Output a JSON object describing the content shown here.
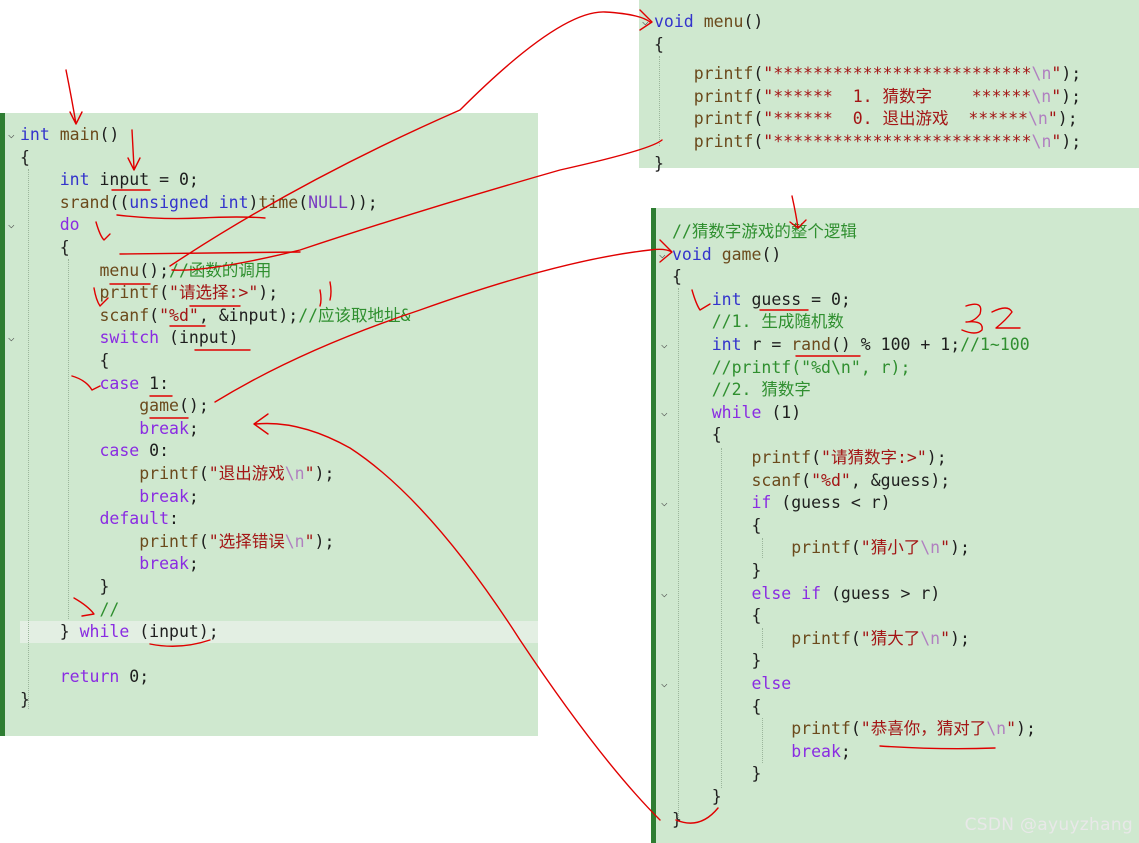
{
  "main_panel": {
    "lines": [
      "int main()",
      "{",
      "    int input = 0;",
      "    srand((unsigned int)time(NULL));",
      "    do",
      "    {",
      "        menu();//函数的调用",
      "        printf(\"请选择:>\");",
      "        scanf(\"%d\", &input);//应该取地址&",
      "        switch (input)",
      "        {",
      "        case 1:",
      "            game();",
      "            break;",
      "        case 0:",
      "            printf(\"退出游戏\\n\");",
      "            break;",
      "        default:",
      "            printf(\"选择错误\\n\");",
      "            break;",
      "        }",
      "        //",
      "    } while (input);",
      "",
      "    return 0;",
      "}"
    ]
  },
  "menu_panel": {
    "lines": [
      "void menu()",
      "{",
      "    printf(\"**************************\\n\");",
      "    printf(\"******  1. 猜数字    ******\\n\");",
      "    printf(\"******  0. 退出游戏  ******\\n\");",
      "    printf(\"**************************\\n\");",
      "}"
    ]
  },
  "game_panel": {
    "lines": [
      "//猜数字游戏的整个逻辑",
      "void game()",
      "{",
      "    int guess = 0;",
      "    //1. 生成随机数",
      "    int r = rand() % 100 + 1;//1~100",
      "    //printf(\"%d\\n\", r);",
      "    //2. 猜数字",
      "    while (1)",
      "    {",
      "        printf(\"请猜数字:>\");",
      "        scanf(\"%d\", &guess);",
      "        if (guess < r)",
      "        {",
      "            printf(\"猜小了\\n\");",
      "        }",
      "        else if (guess > r)",
      "        {",
      "            printf(\"猜大了\\n\");",
      "        }",
      "        else",
      "        {",
      "            printf(\"恭喜你, 猜对了\\n\");",
      "            break;",
      "        }",
      "    }",
      "}"
    ]
  },
  "annotation": {
    "handwritten_number": "32",
    "ink_color": "#e00000"
  },
  "watermark": "CSDN @ayuyzhang"
}
